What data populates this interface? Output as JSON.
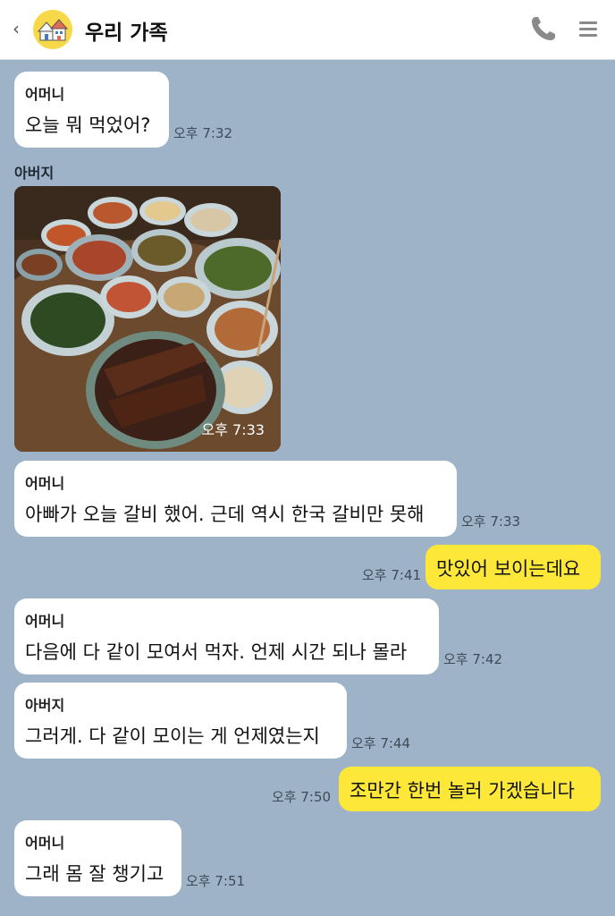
{
  "header": {
    "back_glyph": "‹",
    "title": "우리 가족",
    "avatar_icon": "family-house-icon",
    "call_icon": "phone-icon",
    "menu_icon": "hamburger-menu-icon"
  },
  "messages": [
    {
      "sender": "어머니",
      "text": "오늘 뭐 먹었어?",
      "time": "오후 7:32"
    },
    {
      "sender": "아버지",
      "image": "korean-table-food-photo",
      "time": "오후 7:33"
    },
    {
      "sender": "어머니",
      "text": "아빠가 오늘 갈비 했어. 근데 역시 한국 갈비만 못해",
      "time": "오후 7:33"
    },
    {
      "sender": "me",
      "text": "맛있어 보이는데요",
      "time": "오후 7:41"
    },
    {
      "sender": "어머니",
      "text": "다음에 다 같이 모여서 먹자. 언제 시간 되나 몰라",
      "time": "오후 7:42"
    },
    {
      "sender": "아버지",
      "text": "그러게. 다 같이 모이는 게 언제였는지",
      "time": "오후 7:44"
    },
    {
      "sender": "me",
      "text": "조만간 한번 놀러 가겠습니다",
      "time": "오후 7:50"
    },
    {
      "sender": "어머니",
      "text": "그래 몸 잘 챙기고",
      "time": "오후 7:51"
    }
  ],
  "colors": {
    "chat_background": "#9fb3c8",
    "my_bubble": "#fde83a",
    "other_bubble": "#ffffff",
    "avatar": "#f7d84a"
  }
}
